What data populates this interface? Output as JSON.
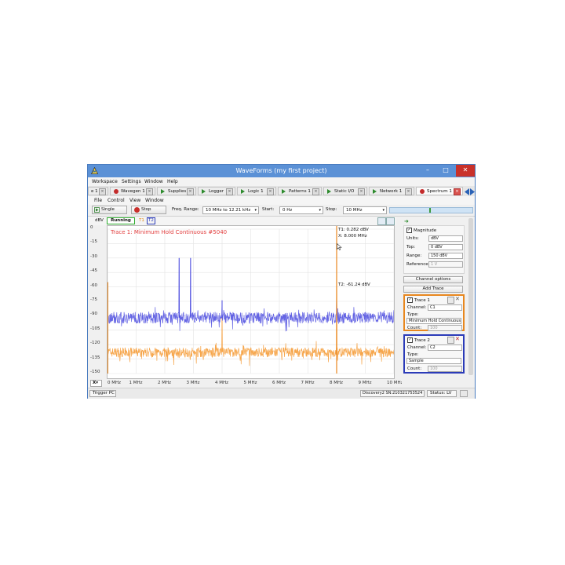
{
  "window": {
    "title": "WaveForms   (my first project)",
    "controls": {
      "minimize": "–",
      "maximize": "□",
      "close": "✕"
    }
  },
  "menubar": [
    "Workspace",
    "Settings",
    "Window",
    "Help"
  ],
  "tabs": [
    {
      "label": "e 1",
      "icon": "none-icon"
    },
    {
      "label": "Wavegen 1",
      "icon": "record-icon"
    },
    {
      "label": "Supplies",
      "icon": "play-icon"
    },
    {
      "label": "Logger",
      "icon": "play-icon"
    },
    {
      "label": "Logic 1",
      "icon": "play-icon"
    },
    {
      "label": "Patterns 1",
      "icon": "play-icon"
    },
    {
      "label": "Static I/O",
      "icon": "play-icon"
    },
    {
      "label": "Network 1",
      "icon": "play-icon"
    },
    {
      "label": "Spectrum 1",
      "icon": "record-icon",
      "active": true
    }
  ],
  "submenu": [
    "File",
    "Control",
    "View",
    "Window"
  ],
  "toolbar": {
    "single_label": "Single",
    "stop_label": "Stop",
    "freq_range_label": "Freq. Range:",
    "freq_range_value": "10 MHz to 12.21 kHz",
    "start_label": "Start:",
    "start_value": "0 Hz",
    "stop_label2": "Stop:",
    "stop_value": "10 MHz"
  },
  "plot_header": {
    "unit": "dBV",
    "status": "Running",
    "t1": "T1",
    "t2": "T2"
  },
  "plot": {
    "trace_title": "Trace 1: Minimum Hold Continuous #5040",
    "cursor_t1_line1": "T1: 0.282 dBV",
    "cursor_t1_line2": "X: 8.000 MHz",
    "cursor_t2": "T2: -61.24 dBV",
    "x_axis_button": "X"
  },
  "chart_data": {
    "type": "line",
    "ylabel": "dBV",
    "yticks": [
      "0",
      "-15",
      "-30",
      "-45",
      "-60",
      "-75",
      "-90",
      "-105",
      "-120",
      "-135",
      "-150"
    ],
    "ylim": [
      -150,
      0
    ],
    "xticks": [
      "0 MHz",
      "1 MHz",
      "2 MHz",
      "3 MHz",
      "4 MHz",
      "5 MHz",
      "6 MHz",
      "7 MHz",
      "8 MHz",
      "9 MHz",
      "10 MHz"
    ],
    "xlim": [
      0,
      10
    ],
    "series": [
      {
        "name": "Trace 1",
        "color": "#f5a142",
        "baseline": -128,
        "noise": 5,
        "peaks": [
          {
            "x": 0.0,
            "y": -55
          },
          {
            "x": 4.0,
            "y": -84
          },
          {
            "x": 8.0,
            "y": 0.282
          }
        ]
      },
      {
        "name": "Trace 2",
        "color": "#4a4adf",
        "baseline": -92,
        "noise": 6,
        "peaks": [
          {
            "x": 0.0,
            "y": -60
          },
          {
            "x": 2.5,
            "y": -30
          },
          {
            "x": 2.9,
            "y": -30
          },
          {
            "x": 4.0,
            "y": -74
          },
          {
            "x": 8.0,
            "y": -61.24
          }
        ]
      }
    ],
    "grid": true
  },
  "side": {
    "magnitude_label": "Magnitude",
    "units_label": "Units:",
    "units_value": "dBV",
    "top_label": "Top:",
    "top_value": "0 dBV",
    "range_label": "Range:",
    "range_value": "150 dBV",
    "reference_label": "Reference:",
    "reference_value": "1 V",
    "channel_options": "Channel options",
    "add_trace": "Add Trace",
    "trace1": {
      "title": "Trace 1",
      "channel_label": "Channel:",
      "channel_value": "C1",
      "type_label": "Type:",
      "type_value": "Minimum Hold Continuous",
      "count_label": "Count:",
      "count_value": "100",
      "color": "#e8871e"
    },
    "trace2": {
      "title": "Trace 2",
      "channel_label": "Channel:",
      "channel_value": "C2",
      "type_label": "Type:",
      "type_value": "Sample",
      "count_label": "Count:",
      "count_value": "100",
      "color": "#2b3bb8"
    }
  },
  "status": {
    "trigger": "Trigger PC",
    "device": "Discovery2 SN:210321753524",
    "status": "Status: LV"
  }
}
